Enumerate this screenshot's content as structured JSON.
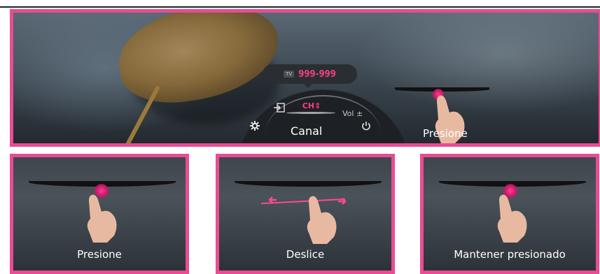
{
  "hero": {
    "tooltip": {
      "source": "TV",
      "channel_number": "999-999"
    },
    "menu": {
      "input_icon": "input-icon",
      "channel_label": "CH⇕",
      "volume_label": "Vol ±",
      "settings_icon": "gear-icon",
      "power_icon": "power-icon",
      "mode_label": "Canal"
    },
    "gesture_label": "Presione"
  },
  "panels": [
    {
      "label": "Presione"
    },
    {
      "label": "Deslice"
    },
    {
      "label": "Mantener presionado"
    }
  ],
  "colors": {
    "accent": "#e94c93",
    "channel_text": "#f0417f"
  }
}
